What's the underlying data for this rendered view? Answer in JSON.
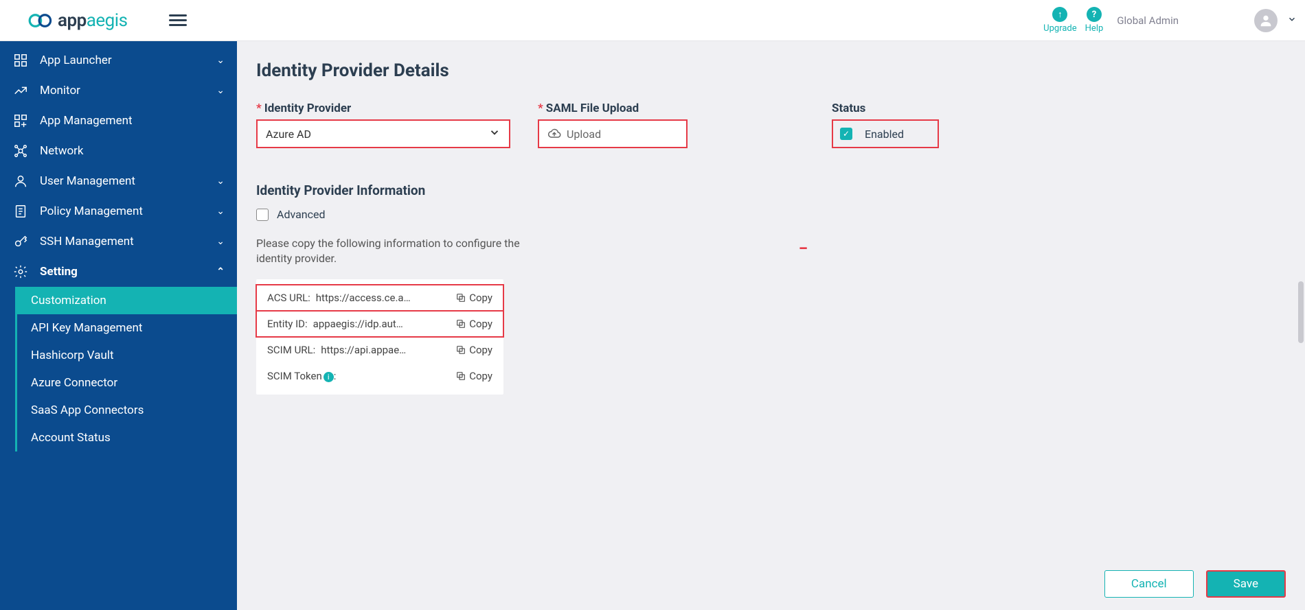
{
  "header": {
    "brand_main": "app",
    "brand_accent": "aegis",
    "upgrade": "Upgrade",
    "help": "Help",
    "user_role": "Global Admin"
  },
  "sidebar": {
    "items": [
      {
        "label": "App Launcher"
      },
      {
        "label": "Monitor"
      },
      {
        "label": "App Management"
      },
      {
        "label": "Network"
      },
      {
        "label": "User Management"
      },
      {
        "label": "Policy Management"
      },
      {
        "label": "SSH Management"
      },
      {
        "label": "Setting"
      }
    ],
    "sub_items": [
      {
        "label": "Customization"
      },
      {
        "label": "API Key Management"
      },
      {
        "label": "Hashicorp Vault"
      },
      {
        "label": "Azure Connector"
      },
      {
        "label": "SaaS App Connectors"
      },
      {
        "label": "Account Status"
      }
    ]
  },
  "page": {
    "title": "Identity Provider Details",
    "idp_label": "Identity Provider",
    "idp_value": "Azure AD",
    "saml_label": "SAML File Upload",
    "upload_text": "Upload",
    "status_label": "Status",
    "status_value": "Enabled",
    "info_title": "Identity Provider Information",
    "advanced_label": "Advanced",
    "info_text": "Please copy the following information to configure the identity provider.",
    "rows": [
      {
        "k": "ACS URL:",
        "v": "https://access.ce.a…"
      },
      {
        "k": "Entity ID:",
        "v": "appaegis://idp.aut…"
      },
      {
        "k": "SCIM URL:",
        "v": "https://api.appae…"
      },
      {
        "k": "SCIM Token",
        "v": ""
      }
    ],
    "copy_label": "Copy",
    "cancel": "Cancel",
    "save": "Save"
  }
}
